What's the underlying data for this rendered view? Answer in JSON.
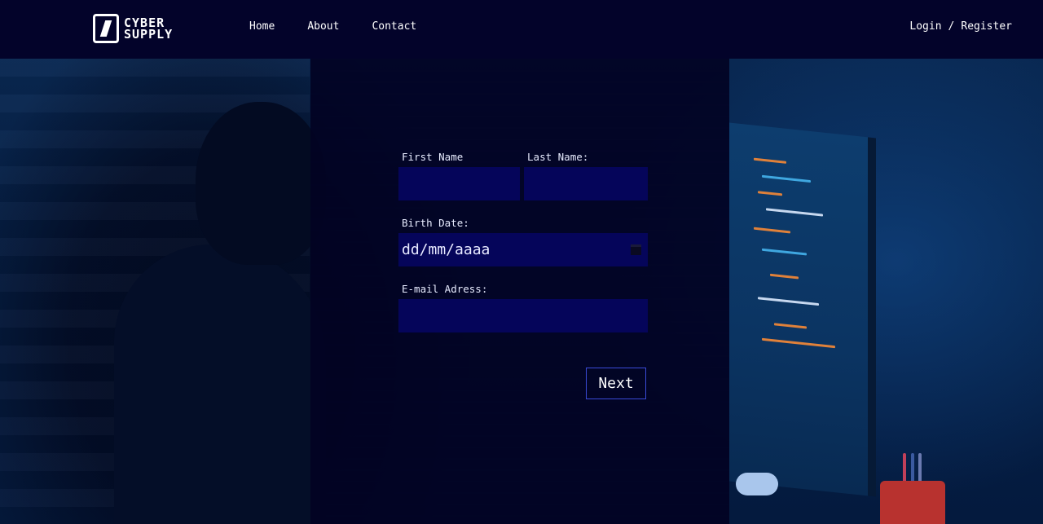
{
  "brand": {
    "logo_line1": "CYBER",
    "logo_line2": "SUPPLY"
  },
  "nav": {
    "items": [
      {
        "label": "Home"
      },
      {
        "label": "About"
      },
      {
        "label": "Contact"
      }
    ]
  },
  "auth": {
    "login_label": "Login",
    "separator": "/",
    "register_label": "Register"
  },
  "form": {
    "first_name": {
      "label": "First Name",
      "value": ""
    },
    "last_name": {
      "label": "Last Name:",
      "value": ""
    },
    "birth_date": {
      "label": "Birth Date:",
      "placeholder": "dd/mm/aaaa"
    },
    "email": {
      "label": "E-mail Adress:",
      "value": ""
    },
    "next_label": "Next"
  },
  "colors": {
    "header_bg": "#03032a",
    "panel_bg": "#020222",
    "field_bg": "#05055a",
    "button_border": "#3a4bd8"
  },
  "icons": {
    "calendar": "calendar-icon"
  }
}
